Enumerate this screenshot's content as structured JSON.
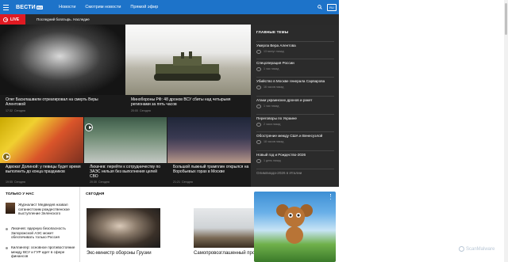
{
  "header": {
    "logo": "ВЕСТИ",
    "logo_sub": "RU",
    "nav": [
      "Новости",
      "Смотрим новости",
      "Прямой эфир"
    ],
    "lang": "RU"
  },
  "live": {
    "badge": "LIVE",
    "ticker": "Последний богатырь. Наследие"
  },
  "news": [
    {
      "title": "Олег Басилашвили отреагировал на смерть Веры Алентовой",
      "time": "17:32",
      "date": "Сегодня"
    },
    {
      "title": "Минобороны РФ: 48 дронов ВСУ сбиты над четырьмя регионами за пять часов",
      "time": "20:00",
      "date": "Сегодня"
    },
    {
      "title": "Адвокат Долиной: у певицы будет время выполнить до конца праздников",
      "time": "19:55",
      "date": "Сегодня"
    },
    {
      "title": "Лихачев: перейти к сотрудничеству по ЗАЭС нельзя без выполнения целей СВО",
      "time": "20:30",
      "date": "Сегодня"
    },
    {
      "title": "Большой лыжный трамплин открылся на Воробьевых горах в Москве",
      "time": "21:21",
      "date": "Сегодня"
    }
  ],
  "topics": {
    "title": "ГЛАВНЫЕ ТЕМЫ",
    "items": [
      {
        "title": "Умерла Вера Алентова",
        "meta": "13 минут назад"
      },
      {
        "title": "Спецоперация России",
        "meta": "1 час назад"
      },
      {
        "title": "Убийство в Москве генерала Сарварова",
        "meta": "16 часов назад"
      },
      {
        "title": "Атаки украинских дронов и ракет",
        "meta": "1 час назад"
      },
      {
        "title": "Переговоры по Украине",
        "meta": "2 часа назад"
      },
      {
        "title": "Обострение между США и Венесуэлой",
        "meta": "18 часов назад"
      },
      {
        "title": "Новый год и Рождество-2026",
        "meta": "1 день назад"
      },
      {
        "title": "Олимпиада-2026 в Италии",
        "meta": ""
      }
    ]
  },
  "only_us": {
    "title": "ТОЛЬКО У НАС",
    "items": [
      "Журналист Медведев назвал сатанистским рождественское выступление Зеленского",
      "Лихачев: ядерную безопасность Запорожской АЭС может обеспечивать только Россия",
      "Киллингер: основное противостояние между ВСУ и ГУР идет в сфере финансов"
    ]
  },
  "today": {
    "title": "СЕГОДНЯ",
    "cards": [
      {
        "title": "Экс-министр обороны Грузии"
      },
      {
        "title": "Самопровозглашенный пророк"
      }
    ]
  },
  "watermark": "ScanMalware",
  "colors": {
    "brand": "#1d73c9",
    "live": "#e01a22",
    "dark": "#1a1a1a"
  }
}
